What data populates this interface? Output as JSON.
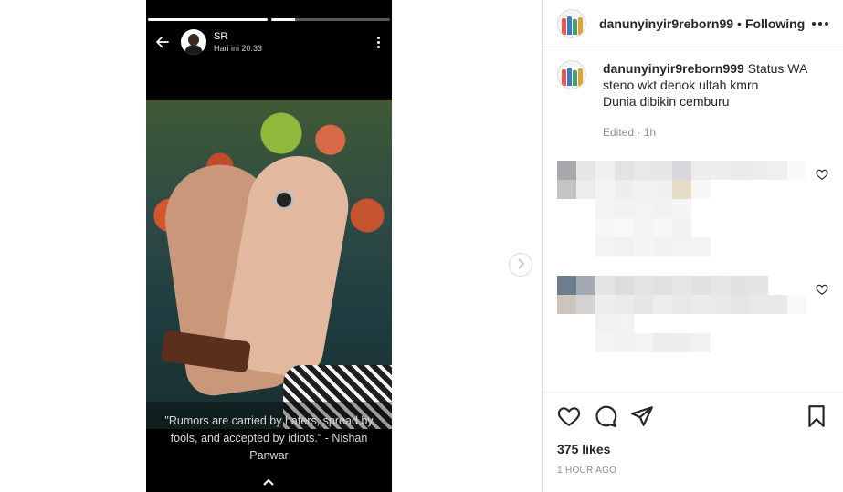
{
  "story": {
    "author_name": "SR",
    "time": "Hari ini 20.33",
    "progress": [
      1,
      0.2
    ],
    "quote": "\"Rumors are carried by haters, spread by fools, and accepted by idiots.\" - Nishan Panwar",
    "icons": {
      "back": "back-arrow-icon",
      "more": "more-vertical-icon",
      "up": "chevron-up-icon"
    }
  },
  "navigation": {
    "next_icon": "chevron-right-icon"
  },
  "post_header": {
    "username": "danunyinyir9reborn99",
    "separator": "•",
    "follow_label": "Following",
    "more_icon": "more-horizontal-icon"
  },
  "caption": {
    "username": "danunyinyir9reborn999",
    "lines": [
      "Status WA",
      "steno wkt denok ultah kmrn",
      "Dunia dibikin cemburu"
    ],
    "meta": "Edited · 1h"
  },
  "actions": {
    "icons": [
      "heart-icon",
      "comment-icon",
      "share-icon",
      "bookmark-icon"
    ],
    "likes": "375 likes",
    "posted": "1 HOUR AGO"
  },
  "colors": {
    "text": "#262626",
    "muted": "#8e8e8e",
    "border": "#dbdbdb",
    "story_bg": "#000000"
  }
}
